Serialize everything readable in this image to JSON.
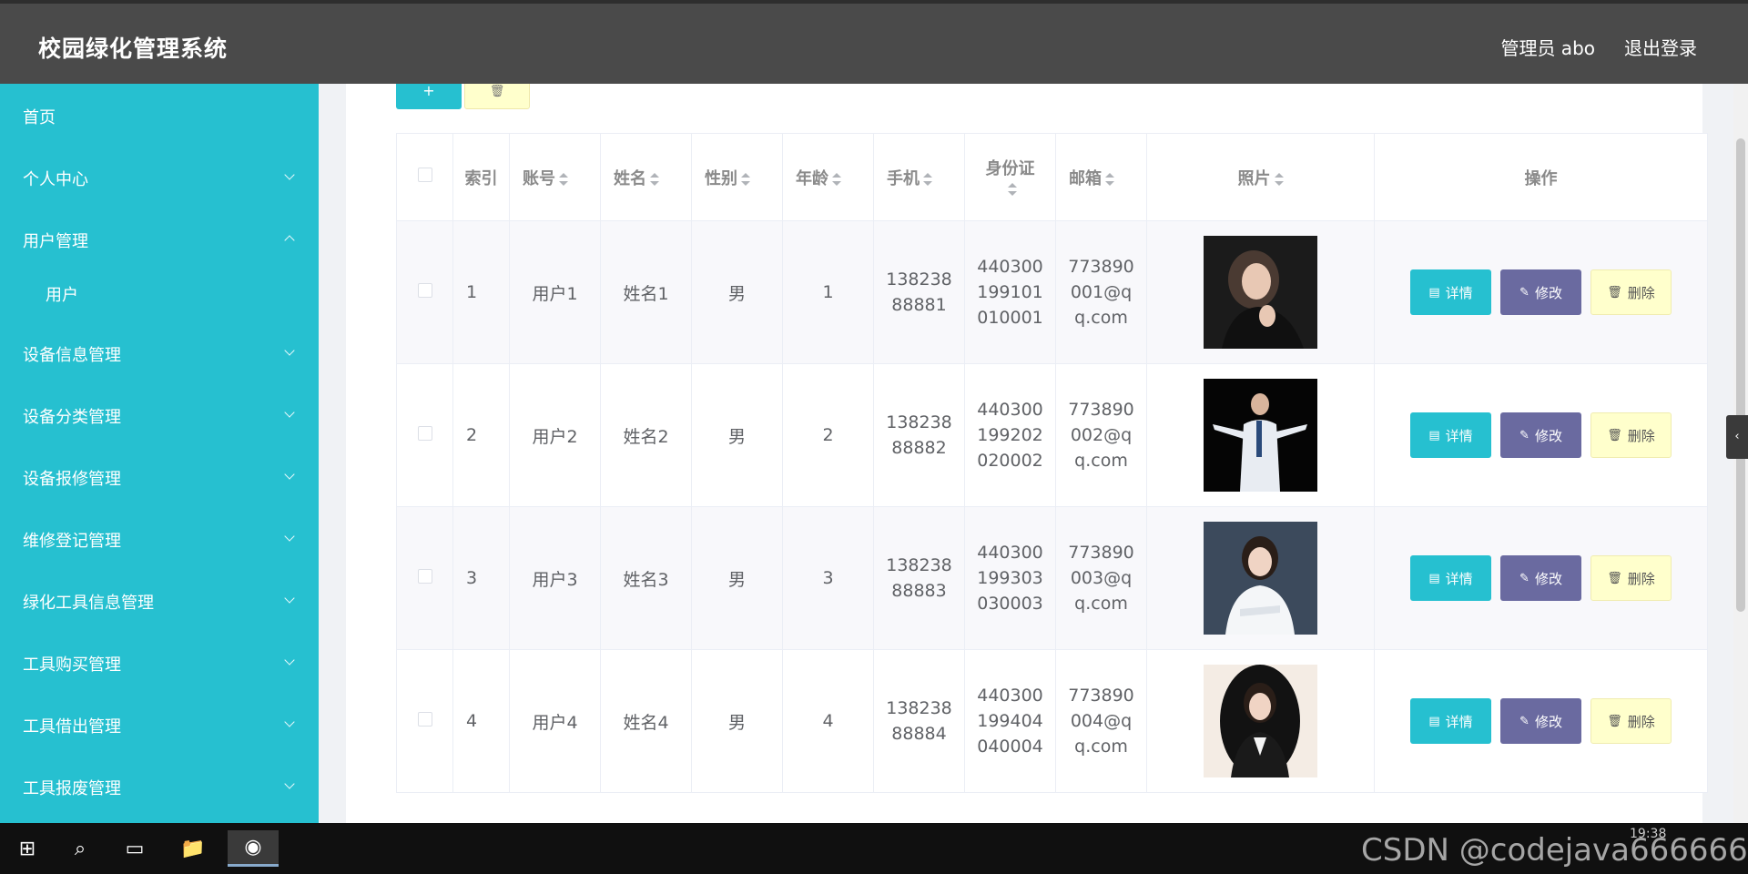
{
  "header": {
    "title": "校园绿化管理系统",
    "admin": "管理员 abo",
    "logout": "退出登录"
  },
  "sidebar": {
    "items": [
      {
        "label": "首页",
        "arrow": "none"
      },
      {
        "label": "个人中心",
        "arrow": "down"
      },
      {
        "label": "用户管理",
        "arrow": "up"
      },
      {
        "label": "用户",
        "arrow": "none",
        "sub": true
      },
      {
        "label": "设备信息管理",
        "arrow": "down"
      },
      {
        "label": "设备分类管理",
        "arrow": "down"
      },
      {
        "label": "设备报修管理",
        "arrow": "down"
      },
      {
        "label": "维修登记管理",
        "arrow": "down"
      },
      {
        "label": "绿化工具信息管理",
        "arrow": "down"
      },
      {
        "label": "工具购买管理",
        "arrow": "down"
      },
      {
        "label": "工具借出管理",
        "arrow": "down"
      },
      {
        "label": "工具报废管理",
        "arrow": "down"
      }
    ]
  },
  "toolbar": {
    "add_label": "+",
    "bulk_delete_icon": "trash-icon"
  },
  "table": {
    "columns": [
      "索引",
      "账号",
      "姓名",
      "性别",
      "年龄",
      "手机",
      "身份证",
      "邮箱",
      "照片",
      "操作"
    ],
    "rows": [
      {
        "index": "1",
        "account": "用户1",
        "name": "姓名1",
        "gender": "男",
        "age": "1",
        "phone": "13823888881",
        "idcard": "440300199101010001",
        "email": "773890001@qq.com"
      },
      {
        "index": "2",
        "account": "用户2",
        "name": "姓名2",
        "gender": "男",
        "age": "2",
        "phone": "13823888882",
        "idcard": "440300199202020002",
        "email": "773890002@qq.com"
      },
      {
        "index": "3",
        "account": "用户3",
        "name": "姓名3",
        "gender": "男",
        "age": "3",
        "phone": "13823888883",
        "idcard": "440300199303030003",
        "email": "773890003@qq.com"
      },
      {
        "index": "4",
        "account": "用户4",
        "name": "姓名4",
        "gender": "男",
        "age": "4",
        "phone": "13823888884",
        "idcard": "440300199404040004",
        "email": "773890004@qq.com"
      }
    ],
    "actions": {
      "detail": "详情",
      "edit": "修改",
      "delete": "删除"
    }
  },
  "taskbar": {
    "watermark": "CSDN @codejava666666",
    "clock": "19:38"
  },
  "colors": {
    "accent": "#26c0d0",
    "edit": "#6a6aa0",
    "delete_bg": "#ffffcc",
    "header_bg": "#4a4a4a"
  }
}
